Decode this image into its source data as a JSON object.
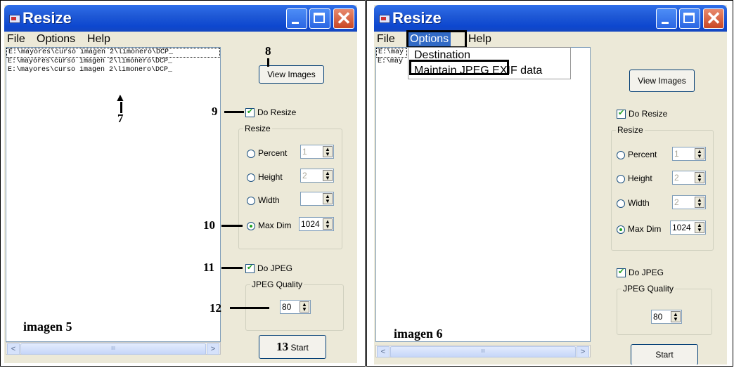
{
  "window": {
    "title": "Resize"
  },
  "menu": {
    "file": "File",
    "options": "Options",
    "help": "Help"
  },
  "files": [
    "E:\\mayores\\curso imagen 2\\limonero\\DCP_",
    "E:\\mayores\\curso imagen 2\\limonero\\DCP_",
    "E:\\mayores\\curso imagen 2\\limonero\\DCP_"
  ],
  "files_truncated": [
    "E:\\may",
    "E:\\may"
  ],
  "controls": {
    "view_images": "View Images",
    "do_resize": "Do Resize",
    "resize_group": "Resize",
    "percent": "Percent",
    "height": "Height",
    "width": "Width",
    "max_dim": "Max Dim",
    "percent_val": "1",
    "height_val": "2",
    "width_val_left": "",
    "width_val_right": "2",
    "max_dim_val": "1024",
    "do_jpeg": "Do JPEG",
    "jpeg_quality": "JPEG Quality",
    "quality_val": "80",
    "start": "Start"
  },
  "options_menu": [
    "Destination",
    "Maintain JPEG EXIF data"
  ],
  "annotations": {
    "n7": "7",
    "n8": "8",
    "n9": "9",
    "n10": "10",
    "n11": "11",
    "n12": "12",
    "n13": "13"
  },
  "captions": {
    "left": "imagen 5",
    "right": "imagen 6"
  },
  "scroll_thumb": "III"
}
